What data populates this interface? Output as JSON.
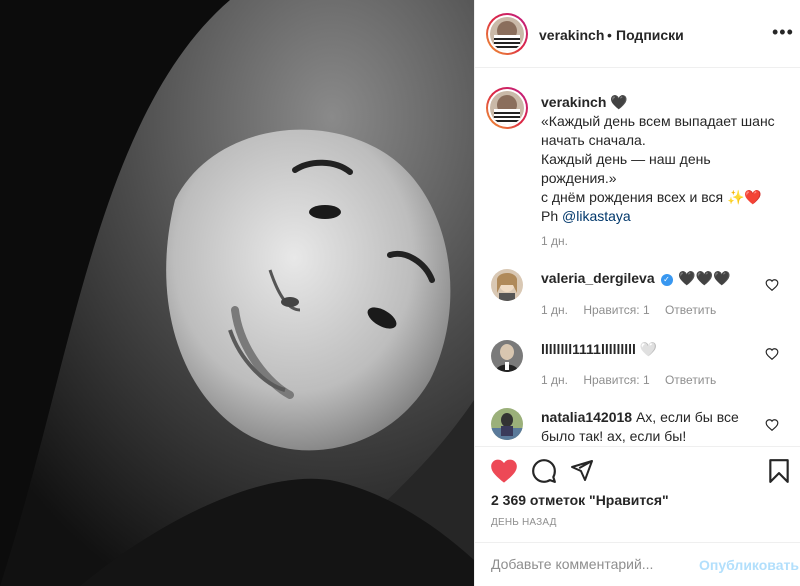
{
  "post": {
    "photo_alt": "black-and-white portrait photo"
  },
  "header": {
    "username": "verakinch",
    "separator": "•",
    "follow_status": "Подписки",
    "more_icon": "more-horizontal-icon"
  },
  "caption": {
    "username": "verakinch",
    "emoji_after_name": "🖤",
    "lines": [
      "«Каждый день всем выпадает шанс",
      "начать сначала.",
      "Каждый день — наш день",
      "рождения.»",
      "с днём рождения всех и вся ✨❤️"
    ],
    "credit_prefix": "Ph ",
    "credit_mention": "@likastaya",
    "time": "1 дн."
  },
  "comments": [
    {
      "username": "valeria_dergileva",
      "verified": true,
      "text": "🖤🖤🖤",
      "time": "1 дн.",
      "likes": "Нравится: 1",
      "reply": "Ответить"
    },
    {
      "username": "llllllll1111lllllllll",
      "verified": false,
      "text": "🤍",
      "time": "1 дн.",
      "likes": "Нравится: 1",
      "reply": "Ответить"
    },
    {
      "username": "natalia142018",
      "verified": false,
      "text": "Ах, если бы все было так! ах, если бы!"
    }
  ],
  "actions": {
    "like_icon": "heart-filled-icon",
    "comment_icon": "comment-icon",
    "share_icon": "share-icon",
    "save_icon": "bookmark-icon",
    "likes_text": "2 369 отметок \"Нравится\"",
    "date_text": "День назад"
  },
  "add_comment": {
    "placeholder": "Добавьте комментарий...",
    "post_label": "Опубликовать"
  },
  "colors": {
    "like_red": "#ed4956",
    "link_blue": "#00376b",
    "post_disabled": "#b2dffc",
    "muted": "#8e8e8e"
  }
}
